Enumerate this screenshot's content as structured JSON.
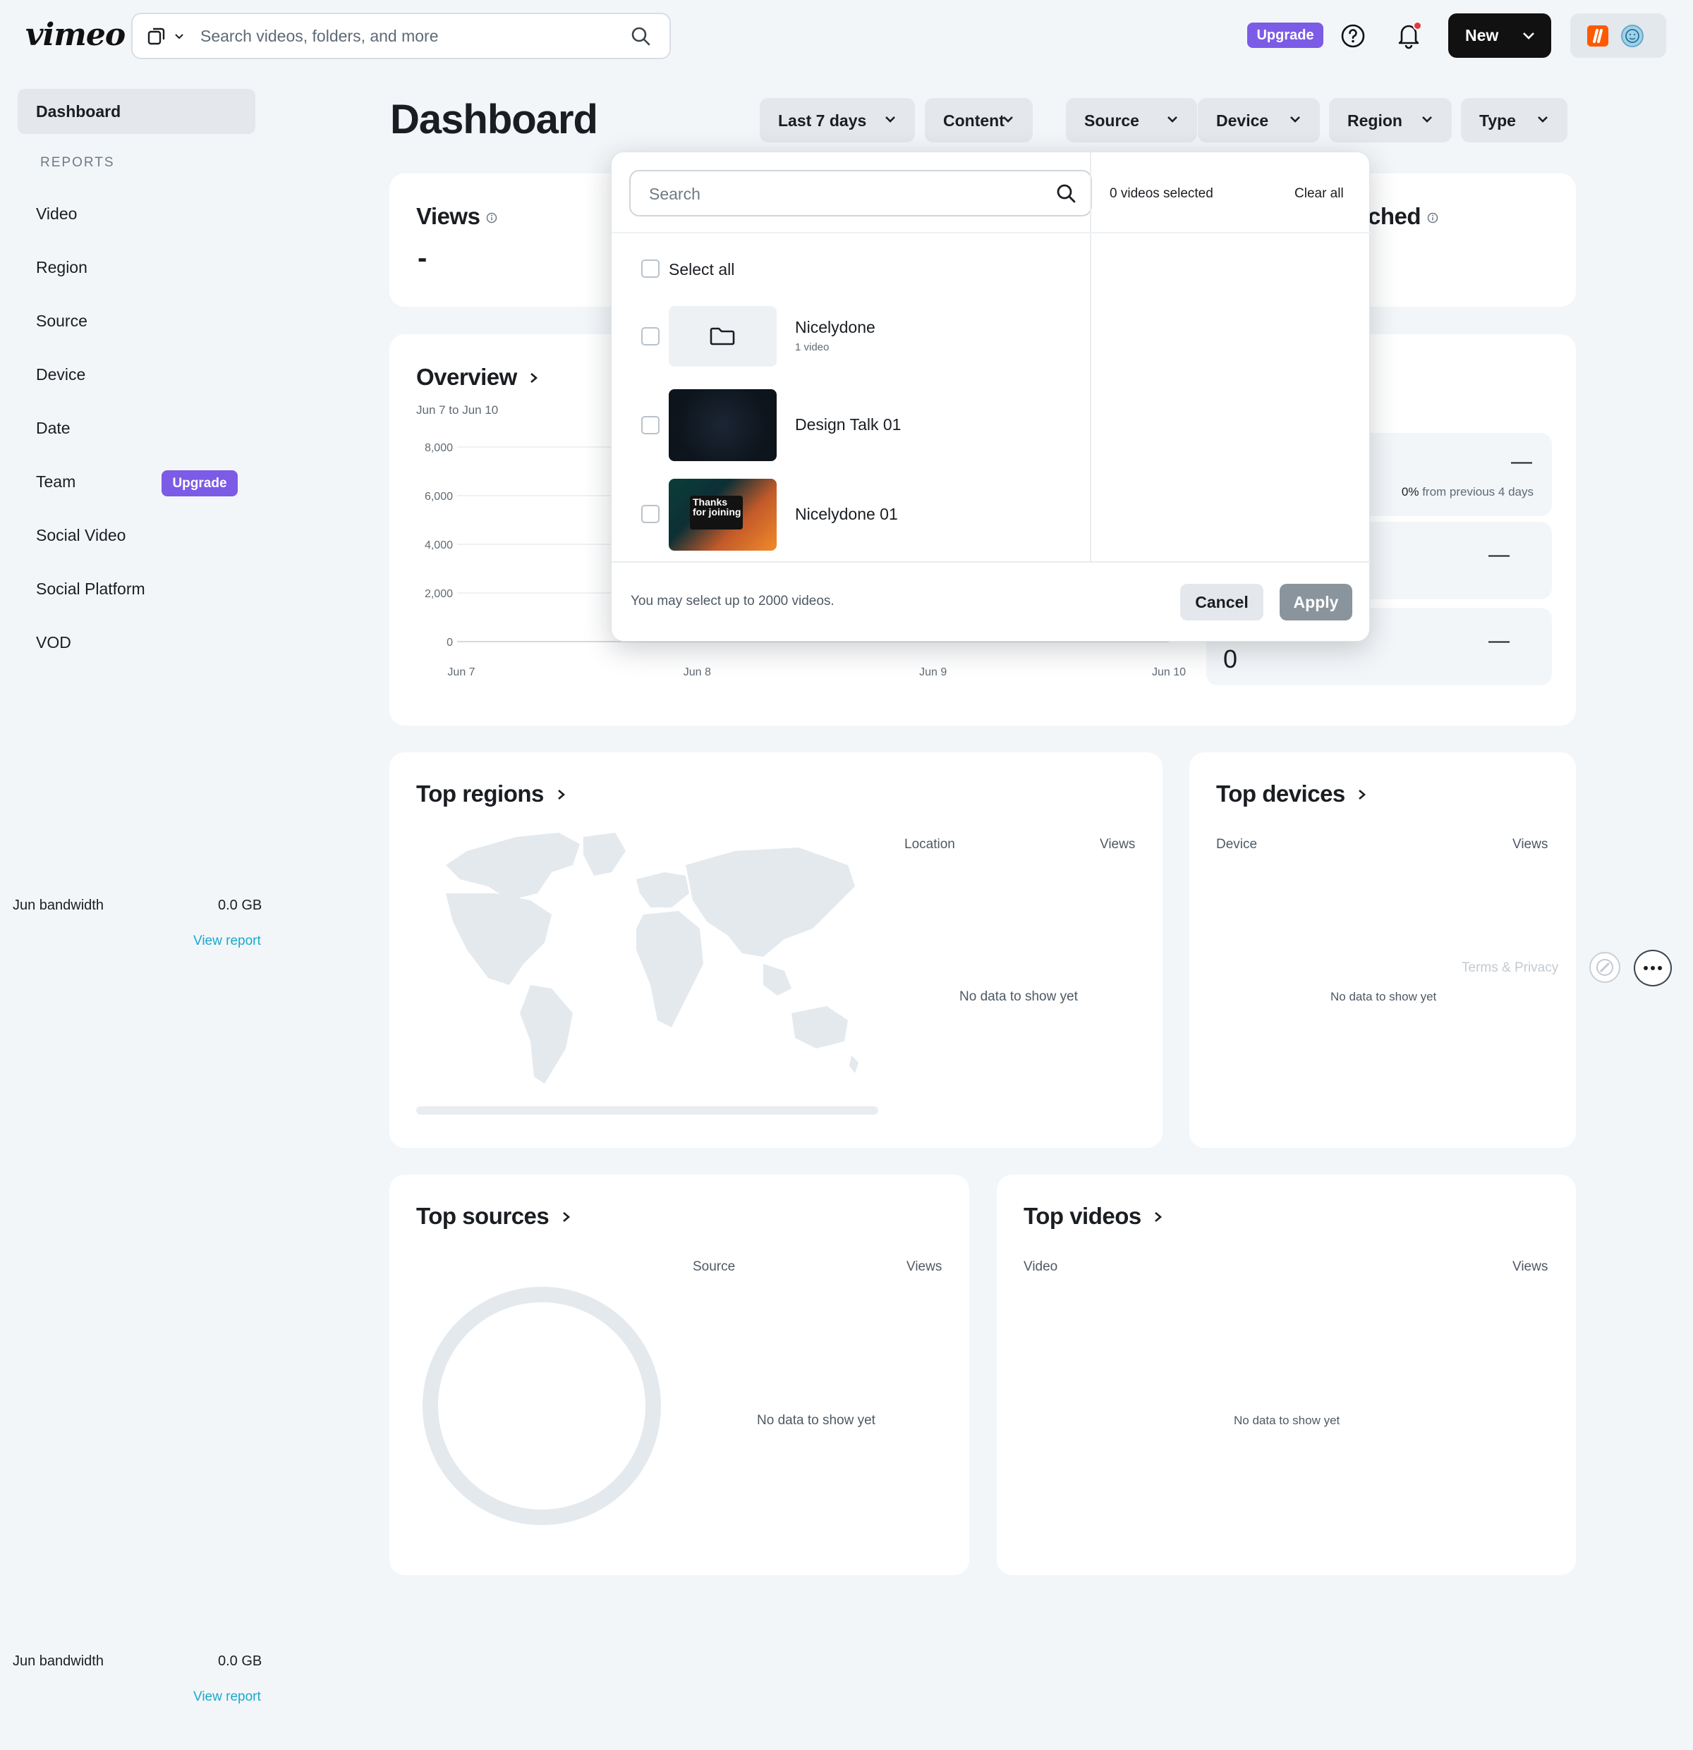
{
  "header": {
    "logo": "vimeo",
    "search_placeholder": "Search videos, folders, and more",
    "upgrade": "Upgrade",
    "new_label": "New"
  },
  "sidebar": {
    "dashboard": "Dashboard",
    "reports_label": "REPORTS",
    "items": [
      "Video",
      "Region",
      "Source",
      "Device",
      "Date",
      "Team",
      "Social Video",
      "Social Platform",
      "VOD"
    ],
    "team_upgrade": "Upgrade",
    "bandwidth_label": "Jun bandwidth",
    "bandwidth_value": "0.0 GB",
    "view_report": "View report"
  },
  "page": {
    "title": "Dashboard",
    "filters": [
      "Last 7 days",
      "Content",
      "Source",
      "Device",
      "Region",
      "Type"
    ]
  },
  "views_card": {
    "title": "Views",
    "value": "-",
    "right_title_fragment": "ched"
  },
  "overview": {
    "title": "Overview",
    "range": "Jun 7 to Jun 10",
    "stat1_change_pct": "0%",
    "stat1_change_text": "from previous 4 days",
    "stat_dash": "—",
    "stat3_value": "0"
  },
  "chart_data": {
    "type": "line",
    "categories": [
      "Jun 7",
      "Jun 8",
      "Jun 9",
      "Jun 10"
    ],
    "y_ticks": [
      "8,000",
      "6,000",
      "4,000",
      "2,000",
      "0"
    ],
    "ylim": [
      0,
      8000
    ],
    "series": [],
    "grid": true
  },
  "top_regions": {
    "title": "Top regions",
    "col_location": "Location",
    "col_views": "Views",
    "nodata": "No data to show yet"
  },
  "top_devices": {
    "title": "Top devices",
    "col_device": "Device",
    "col_views": "Views",
    "nodata": "No data to show yet"
  },
  "top_sources": {
    "title": "Top sources",
    "col_source": "Source",
    "col_views": "Views",
    "nodata": "No data to show yet"
  },
  "top_videos": {
    "title": "Top videos",
    "col_video": "Video",
    "col_views": "Views",
    "nodata": "No data to show yet"
  },
  "footer": {
    "terms": "Terms & Privacy"
  },
  "dropdown": {
    "search_placeholder": "Search",
    "selected": "0 videos selected",
    "clear_all": "Clear all",
    "select_all": "Select all",
    "items": [
      {
        "name": "Nicelydone",
        "sub": "1 video",
        "kind": "folder"
      },
      {
        "name": "Design Talk 01",
        "kind": "video"
      },
      {
        "name": "Nicelydone 01",
        "kind": "video",
        "thumb_text": "Thanks for joining"
      }
    ],
    "footnote": "You may select up to 2000 videos.",
    "cancel": "Cancel",
    "apply": "Apply"
  },
  "colors": {
    "accent": "#7c5be6",
    "link": "#17a9ce",
    "background": "#f3f6f9"
  }
}
